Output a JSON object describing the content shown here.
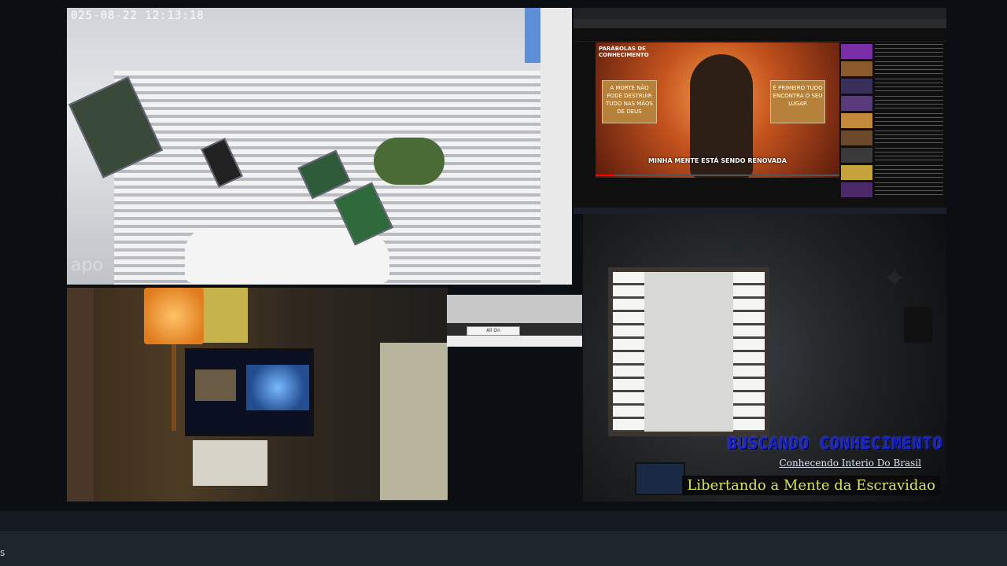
{
  "camera_street": {
    "timestamp": "025-08-22 12:13:18",
    "watermark": "apo"
  },
  "browser": {
    "video_heading": "PARÁBOLAS DE CONHECIMENTO",
    "video_caption": "MINHA MENTE ESTÁ SENDO RENOVADA",
    "thumb_left": "A MORTE NÃO PODE DESTRUIR TUDO NAS MÃOS DE DEUS",
    "thumb_right": "É PRIMEIRO TUDO ENCONTRA O SEU LUGAR"
  },
  "dialog": {
    "button_label": "All On"
  },
  "channel": {
    "title": "BUSCANDO CONHECIMENTO",
    "subtitle": "Conhecendo Interio Do Brasil",
    "slogan": "Libertando a Mente da Escravidao"
  },
  "bottom_bar": {
    "glyph": "s"
  }
}
